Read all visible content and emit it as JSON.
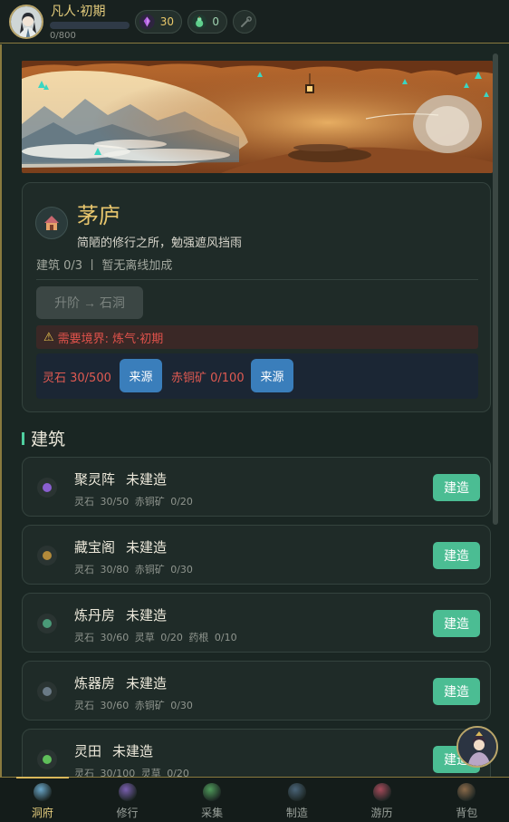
{
  "header": {
    "realm": "凡人·初期",
    "exp_text": "0/800",
    "exp_ratio": 0,
    "spirit_stone": "30",
    "spirit_jade": "0"
  },
  "cave": {
    "title": "茅庐",
    "description": "简陋的修行之所，勉强遮风挡雨",
    "meta": "建筑 0/3 丨 暂无离线加成",
    "upgrade_label": "升阶 → 石洞",
    "warning": "需要境界: 炼气·初期",
    "costs": [
      {
        "label": "灵石 30/500",
        "source_label": "来源"
      },
      {
        "label": "赤铜矿 0/100",
        "source_label": "来源"
      }
    ]
  },
  "section_title": "建筑",
  "buildings": [
    {
      "name": "聚灵阵",
      "status": "未建造",
      "cost": "灵石 30/50  赤铜矿 0/20",
      "action": "建造",
      "icon": "array-icon",
      "color": "#8a5fd0"
    },
    {
      "name": "藏宝阁",
      "status": "未建造",
      "cost": "灵石 30/80  赤铜矿 0/30",
      "action": "建造",
      "icon": "treasure-icon",
      "color": "#b38a3a"
    },
    {
      "name": "炼丹房",
      "status": "未建造",
      "cost": "灵石 30/60  灵草 0/20  药根 0/10",
      "action": "建造",
      "icon": "alchemy-icon",
      "color": "#4a9a78"
    },
    {
      "name": "炼器房",
      "status": "未建造",
      "cost": "灵石 30/60  赤铜矿 0/30",
      "action": "建造",
      "icon": "forge-icon",
      "color": "#6a7a86"
    },
    {
      "name": "灵田",
      "status": "未建造",
      "cost": "灵石 30/100  灵草 0/20",
      "action": "建造",
      "icon": "sprout-icon",
      "color": "#5fbf5a"
    }
  ],
  "nav": [
    {
      "label": "洞府",
      "icon": "cave-icon",
      "color": "#6aa6c8",
      "active": true
    },
    {
      "label": "修行",
      "icon": "lotus-icon",
      "color": "#7a5fb0",
      "active": false
    },
    {
      "label": "采集",
      "icon": "herb-icon",
      "color": "#4f9a5a",
      "active": false
    },
    {
      "label": "制造",
      "icon": "craft-icon",
      "color": "#4a6478",
      "active": false
    },
    {
      "label": "游历",
      "icon": "travel-icon",
      "color": "#a64a5a",
      "active": false
    },
    {
      "label": "背包",
      "icon": "bag-icon",
      "color": "#8a6a4a",
      "active": false
    }
  ]
}
